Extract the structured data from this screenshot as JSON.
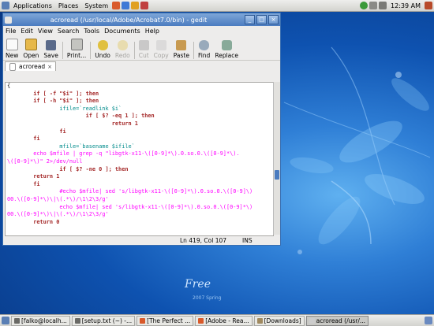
{
  "top_panel": {
    "menus": [
      "Applications",
      "Places",
      "System"
    ],
    "clock": "12:39 AM"
  },
  "window": {
    "title": "acroread (/usr/local/Adobe/Acrobat7.0/bin) - gedit",
    "controls": {
      "minimize": "_",
      "maximize": "□",
      "close": "×"
    },
    "menu": [
      "File",
      "Edit",
      "View",
      "Search",
      "Tools",
      "Documents",
      "Help"
    ],
    "toolbar": {
      "new": "New",
      "open": "Open",
      "save": "Save",
      "print": "Print...",
      "undo": "Undo",
      "redo": "Redo",
      "cut": "Cut",
      "copy": "Copy",
      "paste": "Paste",
      "find": "Find",
      "replace": "Replace"
    },
    "tab": {
      "label": "acroread",
      "close": "×"
    },
    "status": {
      "position": "Ln 419, Col 107",
      "mode": "INS"
    }
  },
  "code_lines": [
    "{",
    "        if [ -f \"$i\" ]; then",
    "        if [ -h \"$i\" ]; then",
    "                ifile=`readlink $i`",
    "                        if [ $? -eq 1 ]; then",
    "                                return 1",
    "                fi",
    "        fi",
    "",
    "                mfile=`basename $ifile`",
    "        echo $mfile | grep -q \"libgtk-x11-\\([0-9]*\\).0.so.0.\\([0-9]*\\).",
    "\\([0-9]*\\)\" 2>/dev/null",
    "",
    "                if [ $? -ne 0 ]; then",
    "        return 1",
    "        fi",
    "",
    "                #echo $mfile| sed 's/libgtk-x11-\\([0-9]*\\).0.so.0.\\([0-9]\\)",
    "00.\\([0-9]*\\)\\|\\(.*\\)/\\1\\2\\3/g'",
    "                echo $mfile| sed 's/libgtk-x11-\\([0-9]*\\).0.so.0.\\([0-9]*\\)",
    "00.\\([0-9]*\\)\\|\\(.*\\)/\\1\\2\\3/g'",
    "        return 0"
  ],
  "taskbar": [
    "[falko@localh...",
    "[setup.txt (~) -...",
    "[The Perfect ...",
    "[Adobe - Rea...",
    "[Downloads]",
    "acroread (/usr/..."
  ],
  "wallpaper": {
    "brand": "Free",
    "sub": "2007 Spring"
  },
  "colors": {
    "title_bar": "#4b7cc0",
    "keyword": "#a52a2a",
    "string": "#ff00ff",
    "variable": "#008b8b",
    "highlight": "#ffff60"
  }
}
